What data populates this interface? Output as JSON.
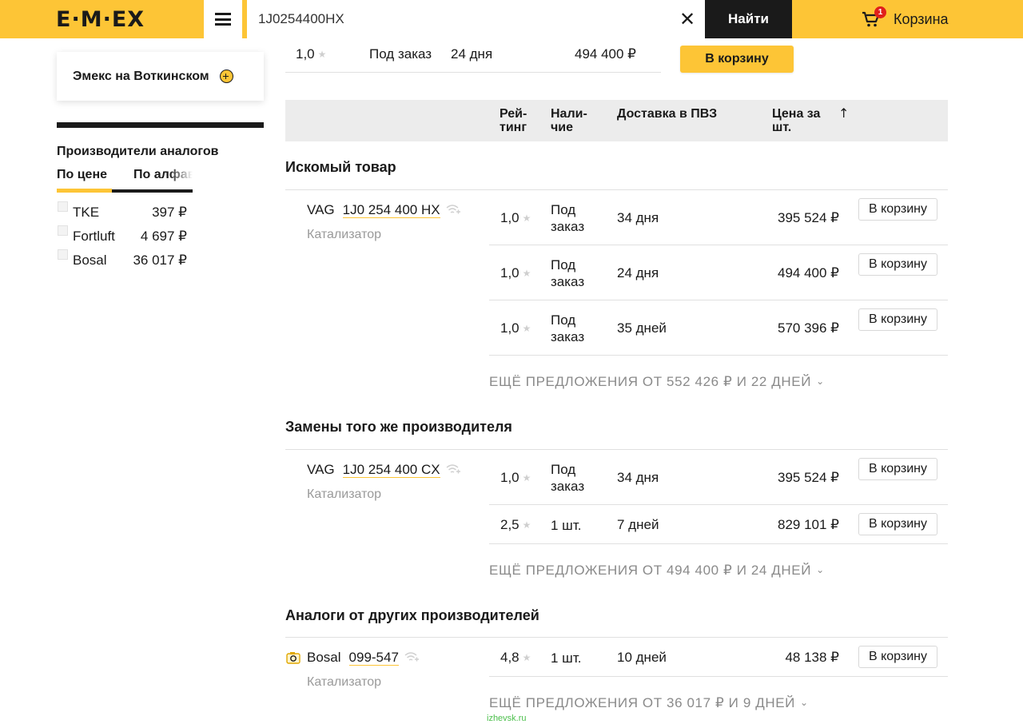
{
  "header": {
    "logo_text": "E·M·EX",
    "search_value": "1J0254400HX",
    "clear_symbol": "✕",
    "find_label": "Найти",
    "cart_label": "Корзина",
    "cart_count": "1",
    "accent_color": "#fdc536"
  },
  "sidebar": {
    "store_name": "Эмекс на Воткинском",
    "analogs_title": "Производители аналогов",
    "sort_tabs": [
      "По цене",
      "По алфавиту"
    ],
    "manufacturers": [
      {
        "name": "TKE",
        "price": "397 ₽"
      },
      {
        "name": "Fortluft",
        "price": "4 697 ₽"
      },
      {
        "name": "Bosal",
        "price": "36 017 ₽"
      }
    ]
  },
  "top_offer": {
    "rating": "1,0",
    "availability": "Под заказ",
    "delivery": "24 дня",
    "price": "494 400 ₽",
    "button": "В корзину"
  },
  "table_header": {
    "rating": "Рей-\nтинг",
    "availability": "Нали-\nчие",
    "delivery": "Доставка в ПВЗ",
    "price": "Цена за\nшт.",
    "sort_arrow": "↑"
  },
  "sections": [
    {
      "title": "Искомый товар",
      "product": {
        "brand": "VAG",
        "code": "1J0 254 400 HX",
        "desc": "Катализатор"
      },
      "offers": [
        {
          "rating": "1,0",
          "availability": "Под\nзаказ",
          "delivery": "34 дня",
          "price": "395 524 ₽",
          "button": "В корзину"
        },
        {
          "rating": "1,0",
          "availability": "Под\nзаказ",
          "delivery": "24 дня",
          "price": "494 400 ₽",
          "button": "В корзину"
        },
        {
          "rating": "1,0",
          "availability": "Под\nзаказ",
          "delivery": "35 дней",
          "price": "570 396 ₽",
          "button": "В корзину"
        }
      ],
      "more": "ЕЩЁ ПРЕДЛОЖЕНИЯ ОТ 552 426 ₽ И 22 ДНЕЙ"
    },
    {
      "title": "Замены того же производителя",
      "product": {
        "brand": "VAG",
        "code": "1J0 254 400 CX",
        "desc": "Катализатор"
      },
      "offers": [
        {
          "rating": "1,0",
          "availability": "Под\nзаказ",
          "delivery": "34 дня",
          "price": "395 524 ₽",
          "button": "В корзину"
        },
        {
          "rating": "2,5",
          "availability": "1 шт.",
          "delivery": "7 дней",
          "price": "829 101 ₽",
          "button": "В корзину"
        }
      ],
      "more": "ЕЩЁ ПРЕДЛОЖЕНИЯ ОТ 494 400 ₽ И 24 ДНЕЙ"
    },
    {
      "title": "Аналоги от других производителей",
      "product": {
        "brand": "Bosal",
        "code": "099-547",
        "desc": "Катализатор"
      },
      "offers": [
        {
          "rating": "4,8",
          "availability": "1 шт.",
          "delivery": "10 дней",
          "price": "48 138 ₽",
          "button": "В корзину"
        }
      ],
      "more": "ЕЩЁ ПРЕДЛОЖЕНИЯ ОТ 36 017 ₽ И 9 ДНЕЙ"
    }
  ],
  "watermark": "izhevsk.ru",
  "icons": [
    "menu-icon",
    "close-icon",
    "cart-icon",
    "plus-circle-icon",
    "star-icon",
    "signal-icon",
    "camera-icon",
    "chevron-down-icon"
  ]
}
